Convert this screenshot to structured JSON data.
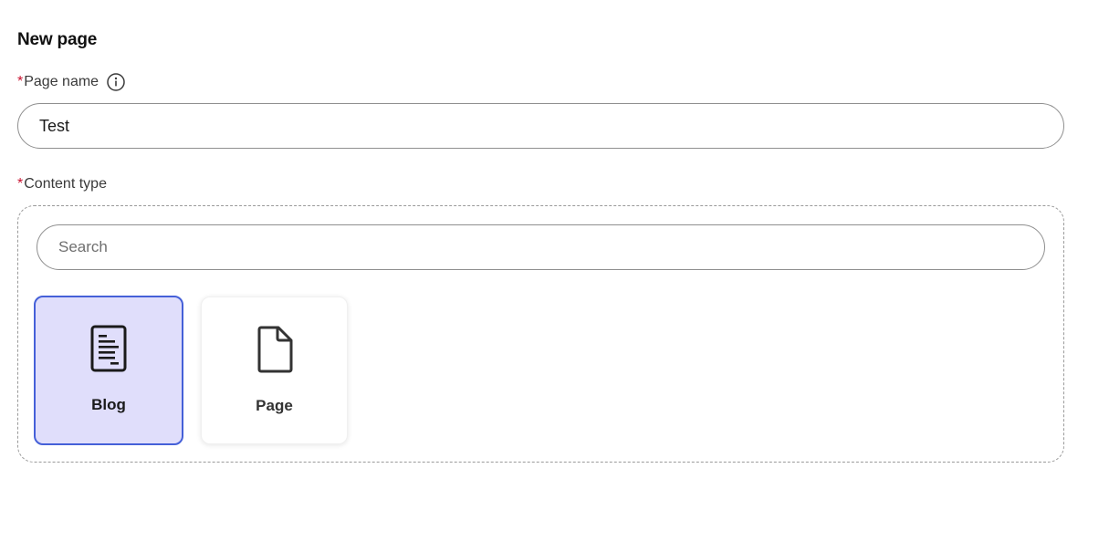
{
  "form": {
    "title": "New page",
    "page_name": {
      "required_marker": "*",
      "label": "Page name",
      "info_icon": "info-icon",
      "value": "Test"
    },
    "content_type": {
      "required_marker": "*",
      "label": "Content type",
      "search_placeholder": "Search",
      "options": [
        {
          "label": "Blog",
          "icon": "blog-document-icon",
          "selected": true
        },
        {
          "label": "Page",
          "icon": "page-file-icon",
          "selected": false
        }
      ]
    }
  },
  "colors": {
    "required": "#c8102e",
    "selected_card_bg": "#e0defb",
    "selected_card_border": "#4560d8",
    "input_border": "#8f8f8f"
  }
}
